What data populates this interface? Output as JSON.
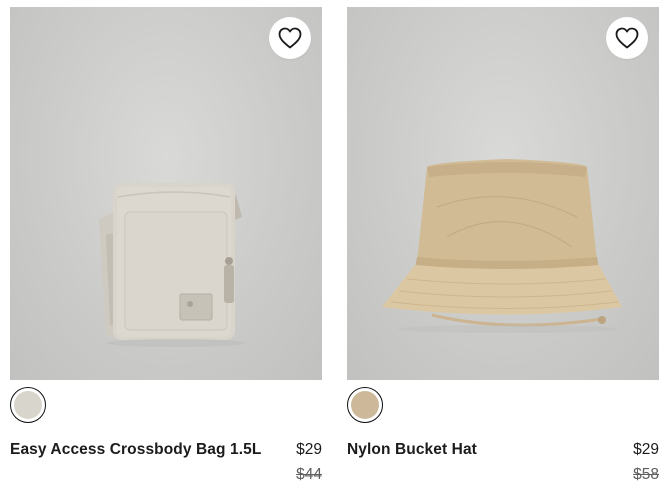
{
  "products": [
    {
      "name": "Easy Access Crossbody Bag 1.5L",
      "price": "$29",
      "original_price": "$44",
      "swatch_color": "#d8d5cc",
      "image_icon": "crossbody-bag-image",
      "favorite_icon": "heart-icon"
    },
    {
      "name": "Nylon Bucket Hat",
      "price": "$29",
      "original_price": "$58",
      "swatch_color": "#cdb89a",
      "image_icon": "bucket-hat-image",
      "favorite_icon": "heart-icon"
    }
  ],
  "colors": {
    "image_bg": "#cacac8",
    "text": "#1b1b1b",
    "strike_price": "#5f5f5f"
  }
}
